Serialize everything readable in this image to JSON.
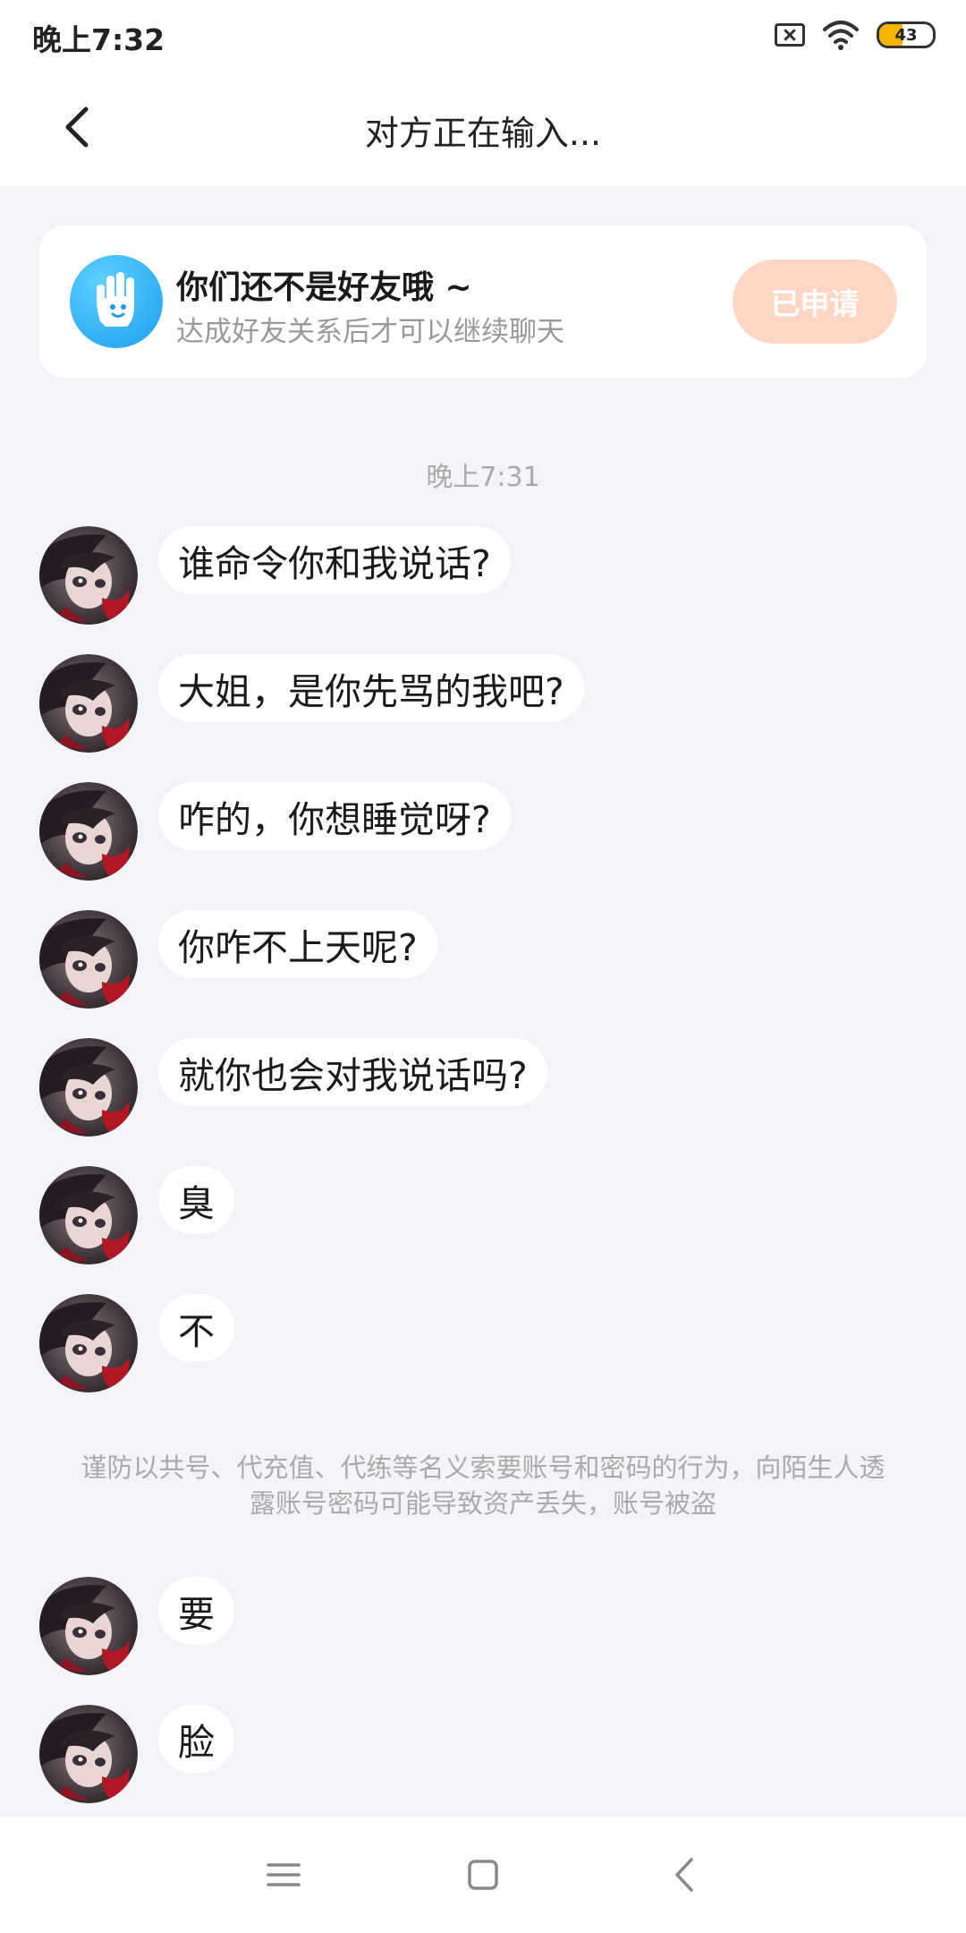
{
  "status_bar": {
    "time": "晚上7:32",
    "battery": "43",
    "battery_level": 0.43
  },
  "header": {
    "title": "对方正在输入..."
  },
  "friend_card": {
    "title": "你们还不是好友哦 ~",
    "subtitle": "达成好友关系后才可以继续聊天",
    "button": "已申请"
  },
  "timestamp": "晚上7:31",
  "messages": [
    "谁命令你和我说话?",
    "大姐，是你先骂的我吧?",
    "咋的，你想睡觉呀?",
    "你咋不上天呢?",
    "就你也会对我说话吗?",
    "臭",
    "不"
  ],
  "safety_notice": "谨防以共号、代充值、代练等名义索要账号和密码的行为，向陌生人透露账号密码可能导致资产丢失，账号被盗",
  "messages_after": [
    "要",
    "脸"
  ],
  "colors": {
    "background": "#f3f4f7",
    "applied_button": "#ffd6c4",
    "hand_icon": "#1a9ff0"
  }
}
